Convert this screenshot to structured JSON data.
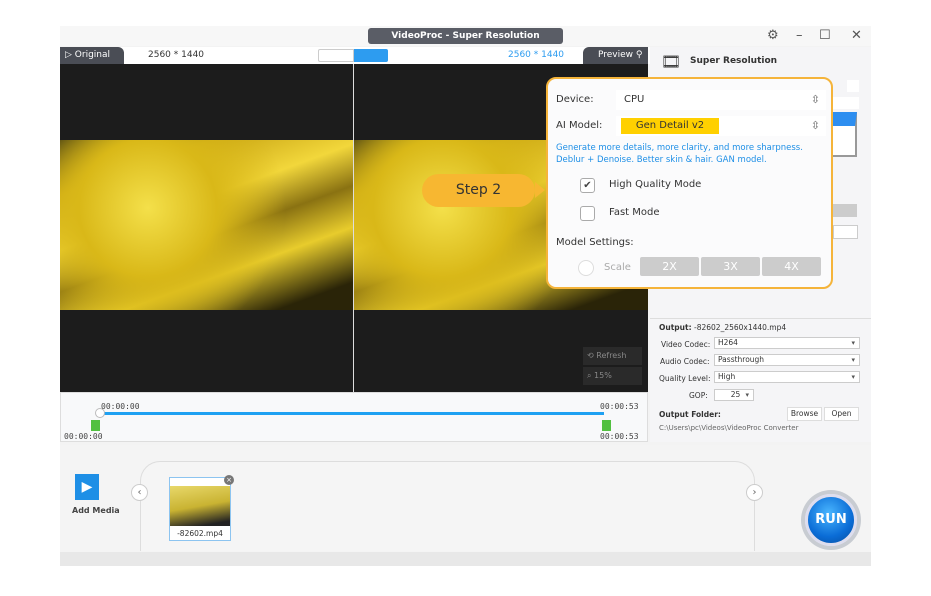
{
  "window": {
    "title": "VideoProc - Super Resolution",
    "settings_icon": "gear-icon",
    "minimize": "–",
    "maximize": "☐",
    "close": "✕"
  },
  "toolbar": {
    "original_label": "Original",
    "left_resolution": "2560 * 1440",
    "right_resolution": "2560 * 1440",
    "preview_label": "Preview"
  },
  "viewer": {
    "refresh_label": "Refresh",
    "zoom_label": "15%"
  },
  "timeline": {
    "start_top": "00:00:00",
    "end_top": "00:00:53",
    "start_bottom": "00:00:00",
    "end_bottom": "00:00:53"
  },
  "panel": {
    "title": "Super Resolution",
    "output_label": "Output:",
    "output_file": "-82602_2560x1440.mp4",
    "video_codec_label": "Video Codec:",
    "video_codec": "H264",
    "audio_codec_label": "Audio Codec:",
    "audio_codec": "Passthrough",
    "quality_label": "Quality Level:",
    "quality": "High",
    "gop_label": "GOP:",
    "gop": "25",
    "folder_label": "Output Folder:",
    "browse": "Browse",
    "open": "Open",
    "folder_path": "C:\\Users\\pc\\Videos\\VideoProc Converter"
  },
  "popup": {
    "device_label": "Device:",
    "device": "CPU",
    "model_label": "AI Model:",
    "model": "Gen Detail v2",
    "description": "Generate more details, more clarity, and more sharpness. Deblur + Denoise. Better skin & hair. GAN model.",
    "hq_label": "High Quality Mode",
    "hq_checked": true,
    "fast_label": "Fast Mode",
    "fast_checked": false,
    "settings_label": "Model Settings:",
    "scale_label": "Scale",
    "scale_options": [
      "2X",
      "3X",
      "4X"
    ],
    "highlight_color": "#ffd000",
    "border_color": "#f5b43a"
  },
  "callout": {
    "label": "Step 2"
  },
  "media": {
    "add_label": "Add Media",
    "file_name": "-82602.mp4",
    "run_label": "RUN"
  }
}
